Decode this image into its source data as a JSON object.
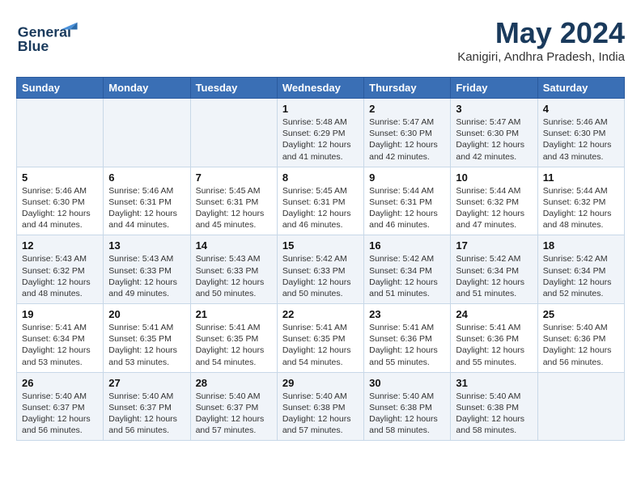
{
  "header": {
    "logo_line1": "General",
    "logo_line2": "Blue",
    "month_year": "May 2024",
    "location": "Kanigiri, Andhra Pradesh, India"
  },
  "days_of_week": [
    "Sunday",
    "Monday",
    "Tuesday",
    "Wednesday",
    "Thursday",
    "Friday",
    "Saturday"
  ],
  "weeks": [
    [
      {
        "day": "",
        "content": ""
      },
      {
        "day": "",
        "content": ""
      },
      {
        "day": "",
        "content": ""
      },
      {
        "day": "1",
        "content": "Sunrise: 5:48 AM\nSunset: 6:29 PM\nDaylight: 12 hours\nand 41 minutes."
      },
      {
        "day": "2",
        "content": "Sunrise: 5:47 AM\nSunset: 6:30 PM\nDaylight: 12 hours\nand 42 minutes."
      },
      {
        "day": "3",
        "content": "Sunrise: 5:47 AM\nSunset: 6:30 PM\nDaylight: 12 hours\nand 42 minutes."
      },
      {
        "day": "4",
        "content": "Sunrise: 5:46 AM\nSunset: 6:30 PM\nDaylight: 12 hours\nand 43 minutes."
      }
    ],
    [
      {
        "day": "5",
        "content": "Sunrise: 5:46 AM\nSunset: 6:30 PM\nDaylight: 12 hours\nand 44 minutes."
      },
      {
        "day": "6",
        "content": "Sunrise: 5:46 AM\nSunset: 6:31 PM\nDaylight: 12 hours\nand 44 minutes."
      },
      {
        "day": "7",
        "content": "Sunrise: 5:45 AM\nSunset: 6:31 PM\nDaylight: 12 hours\nand 45 minutes."
      },
      {
        "day": "8",
        "content": "Sunrise: 5:45 AM\nSunset: 6:31 PM\nDaylight: 12 hours\nand 46 minutes."
      },
      {
        "day": "9",
        "content": "Sunrise: 5:44 AM\nSunset: 6:31 PM\nDaylight: 12 hours\nand 46 minutes."
      },
      {
        "day": "10",
        "content": "Sunrise: 5:44 AM\nSunset: 6:32 PM\nDaylight: 12 hours\nand 47 minutes."
      },
      {
        "day": "11",
        "content": "Sunrise: 5:44 AM\nSunset: 6:32 PM\nDaylight: 12 hours\nand 48 minutes."
      }
    ],
    [
      {
        "day": "12",
        "content": "Sunrise: 5:43 AM\nSunset: 6:32 PM\nDaylight: 12 hours\nand 48 minutes."
      },
      {
        "day": "13",
        "content": "Sunrise: 5:43 AM\nSunset: 6:33 PM\nDaylight: 12 hours\nand 49 minutes."
      },
      {
        "day": "14",
        "content": "Sunrise: 5:43 AM\nSunset: 6:33 PM\nDaylight: 12 hours\nand 50 minutes."
      },
      {
        "day": "15",
        "content": "Sunrise: 5:42 AM\nSunset: 6:33 PM\nDaylight: 12 hours\nand 50 minutes."
      },
      {
        "day": "16",
        "content": "Sunrise: 5:42 AM\nSunset: 6:34 PM\nDaylight: 12 hours\nand 51 minutes."
      },
      {
        "day": "17",
        "content": "Sunrise: 5:42 AM\nSunset: 6:34 PM\nDaylight: 12 hours\nand 51 minutes."
      },
      {
        "day": "18",
        "content": "Sunrise: 5:42 AM\nSunset: 6:34 PM\nDaylight: 12 hours\nand 52 minutes."
      }
    ],
    [
      {
        "day": "19",
        "content": "Sunrise: 5:41 AM\nSunset: 6:34 PM\nDaylight: 12 hours\nand 53 minutes."
      },
      {
        "day": "20",
        "content": "Sunrise: 5:41 AM\nSunset: 6:35 PM\nDaylight: 12 hours\nand 53 minutes."
      },
      {
        "day": "21",
        "content": "Sunrise: 5:41 AM\nSunset: 6:35 PM\nDaylight: 12 hours\nand 54 minutes."
      },
      {
        "day": "22",
        "content": "Sunrise: 5:41 AM\nSunset: 6:35 PM\nDaylight: 12 hours\nand 54 minutes."
      },
      {
        "day": "23",
        "content": "Sunrise: 5:41 AM\nSunset: 6:36 PM\nDaylight: 12 hours\nand 55 minutes."
      },
      {
        "day": "24",
        "content": "Sunrise: 5:41 AM\nSunset: 6:36 PM\nDaylight: 12 hours\nand 55 minutes."
      },
      {
        "day": "25",
        "content": "Sunrise: 5:40 AM\nSunset: 6:36 PM\nDaylight: 12 hours\nand 56 minutes."
      }
    ],
    [
      {
        "day": "26",
        "content": "Sunrise: 5:40 AM\nSunset: 6:37 PM\nDaylight: 12 hours\nand 56 minutes."
      },
      {
        "day": "27",
        "content": "Sunrise: 5:40 AM\nSunset: 6:37 PM\nDaylight: 12 hours\nand 56 minutes."
      },
      {
        "day": "28",
        "content": "Sunrise: 5:40 AM\nSunset: 6:37 PM\nDaylight: 12 hours\nand 57 minutes."
      },
      {
        "day": "29",
        "content": "Sunrise: 5:40 AM\nSunset: 6:38 PM\nDaylight: 12 hours\nand 57 minutes."
      },
      {
        "day": "30",
        "content": "Sunrise: 5:40 AM\nSunset: 6:38 PM\nDaylight: 12 hours\nand 58 minutes."
      },
      {
        "day": "31",
        "content": "Sunrise: 5:40 AM\nSunset: 6:38 PM\nDaylight: 12 hours\nand 58 minutes."
      },
      {
        "day": "",
        "content": ""
      }
    ]
  ]
}
